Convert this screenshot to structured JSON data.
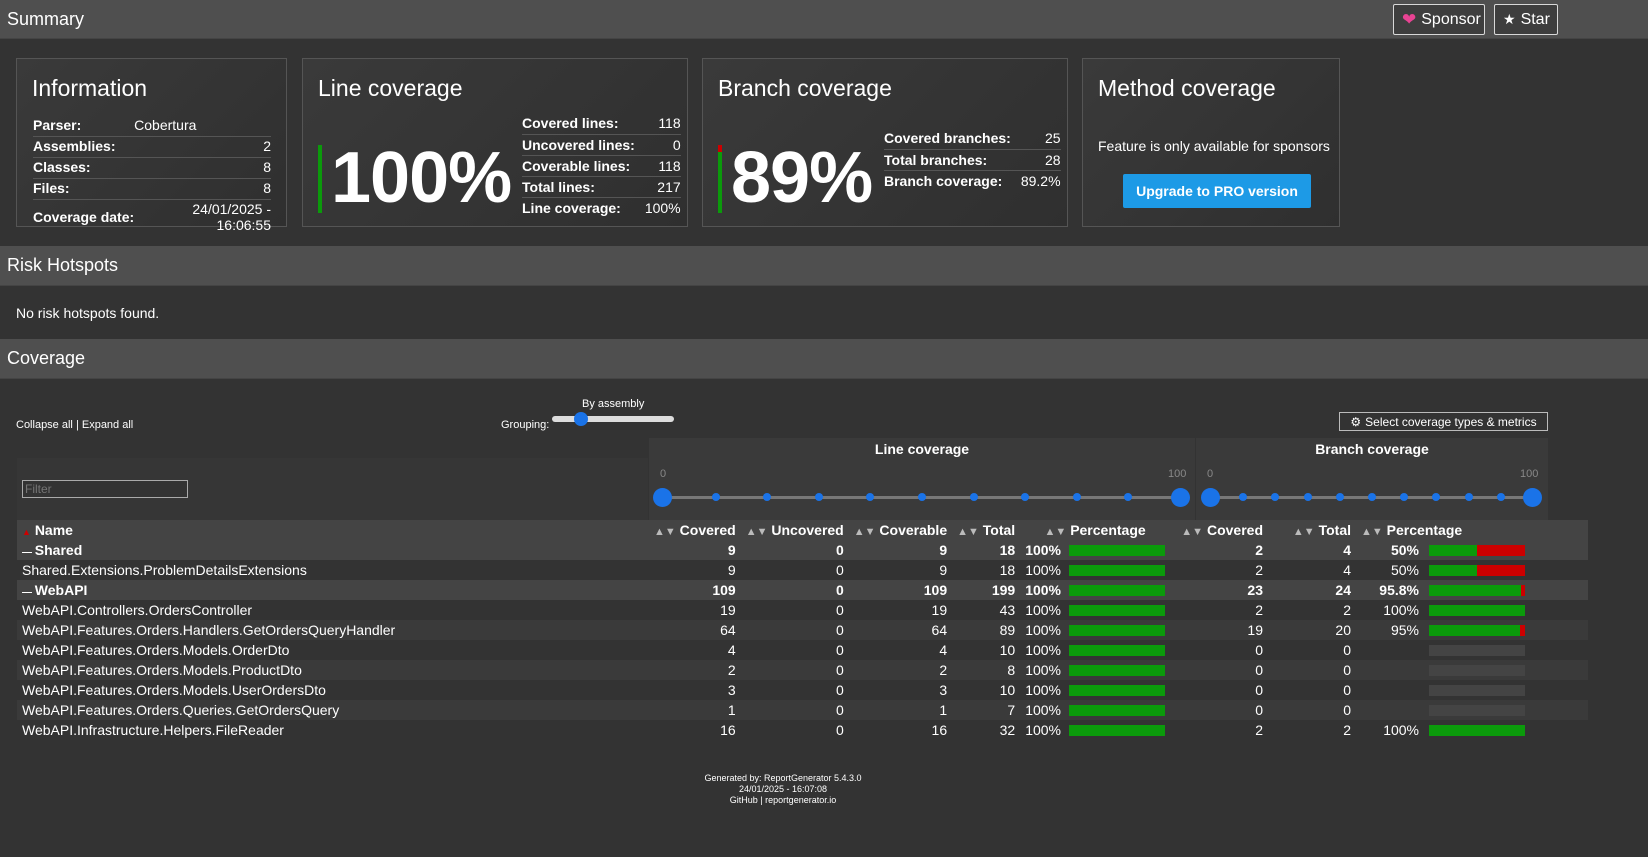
{
  "header": {
    "title": "Summary",
    "sponsor_label": "Sponsor",
    "star_label": "Star"
  },
  "info": {
    "title": "Information",
    "rows": [
      {
        "k": "Parser:",
        "v": "Cobertura"
      },
      {
        "k": "Assemblies:",
        "v": "2"
      },
      {
        "k": "Classes:",
        "v": "8"
      },
      {
        "k": "Files:",
        "v": "8"
      },
      {
        "k": "Coverage date:",
        "v": "24/01/2025 - 16:06:55"
      }
    ]
  },
  "line_coverage": {
    "title": "Line coverage",
    "percent": "100%",
    "rows": [
      {
        "k": "Covered lines:",
        "v": "118"
      },
      {
        "k": "Uncovered lines:",
        "v": "0"
      },
      {
        "k": "Coverable lines:",
        "v": "118"
      },
      {
        "k": "Total lines:",
        "v": "217"
      },
      {
        "k": "Line coverage:",
        "v": "100%"
      }
    ]
  },
  "branch_coverage": {
    "title": "Branch coverage",
    "percent": "89%",
    "rows": [
      {
        "k": "Covered branches:",
        "v": "25"
      },
      {
        "k": "Total branches:",
        "v": "28"
      },
      {
        "k": "Branch coverage:",
        "v": "89.2%"
      }
    ]
  },
  "method_coverage": {
    "title": "Method coverage",
    "text": "Feature is only available for sponsors",
    "button": "Upgrade to PRO version"
  },
  "risk": {
    "title": "Risk Hotspots",
    "text": "No risk hotspots found."
  },
  "coverage": {
    "title": "Coverage",
    "collapse_label": "Collapse all",
    "separator": "|",
    "expand_label": "Expand all",
    "grouping_label": "Grouping:",
    "grouping_value": "By assembly",
    "select_label": "Select coverage types & metrics",
    "filter_placeholder": "Filter",
    "line_header": "Line coverage",
    "branch_header": "Branch coverage",
    "slider_min": "0",
    "slider_max": "100",
    "columns": {
      "name": "Name",
      "covered": "Covered",
      "uncovered": "Uncovered",
      "coverable": "Coverable",
      "total": "Total",
      "percentage": "Percentage",
      "b_covered": "Covered",
      "b_total": "Total",
      "b_percentage": "Percentage"
    },
    "rows": [
      {
        "group": true,
        "name": "Shared",
        "covered": "9",
        "uncovered": "0",
        "coverable": "9",
        "total": "18",
        "pct": "100%",
        "lineFrac": 1,
        "bcov": "2",
        "btot": "4",
        "bpct": "50%",
        "branchFrac": 0.5
      },
      {
        "group": false,
        "name": "Shared.Extensions.ProblemDetailsExtensions",
        "covered": "9",
        "uncovered": "0",
        "coverable": "9",
        "total": "18",
        "pct": "100%",
        "lineFrac": 1,
        "bcov": "2",
        "btot": "4",
        "bpct": "50%",
        "branchFrac": 0.5
      },
      {
        "group": true,
        "name": "WebAPI",
        "covered": "109",
        "uncovered": "0",
        "coverable": "109",
        "total": "199",
        "pct": "100%",
        "lineFrac": 1,
        "bcov": "23",
        "btot": "24",
        "bpct": "95.8%",
        "branchFrac": 0.958
      },
      {
        "group": false,
        "name": "WebAPI.Controllers.OrdersController",
        "covered": "19",
        "uncovered": "0",
        "coverable": "19",
        "total": "43",
        "pct": "100%",
        "lineFrac": 1,
        "bcov": "2",
        "btot": "2",
        "bpct": "100%",
        "branchFrac": 1
      },
      {
        "group": false,
        "name": "WebAPI.Features.Orders.Handlers.GetOrdersQueryHandler",
        "covered": "64",
        "uncovered": "0",
        "coverable": "64",
        "total": "89",
        "pct": "100%",
        "lineFrac": 1,
        "bcov": "19",
        "btot": "20",
        "bpct": "95%",
        "branchFrac": 0.95
      },
      {
        "group": false,
        "name": "WebAPI.Features.Orders.Models.OrderDto",
        "covered": "4",
        "uncovered": "0",
        "coverable": "4",
        "total": "10",
        "pct": "100%",
        "lineFrac": 1,
        "bcov": "0",
        "btot": "0",
        "bpct": "",
        "branchFrac": null
      },
      {
        "group": false,
        "name": "WebAPI.Features.Orders.Models.ProductDto",
        "covered": "2",
        "uncovered": "0",
        "coverable": "2",
        "total": "8",
        "pct": "100%",
        "lineFrac": 1,
        "bcov": "0",
        "btot": "0",
        "bpct": "",
        "branchFrac": null
      },
      {
        "group": false,
        "name": "WebAPI.Features.Orders.Models.UserOrdersDto",
        "covered": "3",
        "uncovered": "0",
        "coverable": "3",
        "total": "10",
        "pct": "100%",
        "lineFrac": 1,
        "bcov": "0",
        "btot": "0",
        "bpct": "",
        "branchFrac": null
      },
      {
        "group": false,
        "name": "WebAPI.Features.Orders.Queries.GetOrdersQuery",
        "covered": "1",
        "uncovered": "0",
        "coverable": "1",
        "total": "7",
        "pct": "100%",
        "lineFrac": 1,
        "bcov": "0",
        "btot": "0",
        "bpct": "",
        "branchFrac": null
      },
      {
        "group": false,
        "name": "WebAPI.Infrastructure.Helpers.FileReader",
        "covered": "16",
        "uncovered": "0",
        "coverable": "16",
        "total": "32",
        "pct": "100%",
        "lineFrac": 1,
        "bcov": "2",
        "btot": "2",
        "bpct": "100%",
        "branchFrac": 1
      }
    ]
  },
  "footer": {
    "line1": "Generated by: ReportGenerator 5.4.3.0",
    "line2": "24/01/2025 - 16:07:08",
    "github": "GitHub",
    "sep": "|",
    "site": "reportgenerator.io"
  },
  "colors": {
    "covered": "#0b9a0b",
    "uncovered": "#cc0000",
    "accent": "#1a73e8",
    "upgrade": "#1d9ae6"
  }
}
